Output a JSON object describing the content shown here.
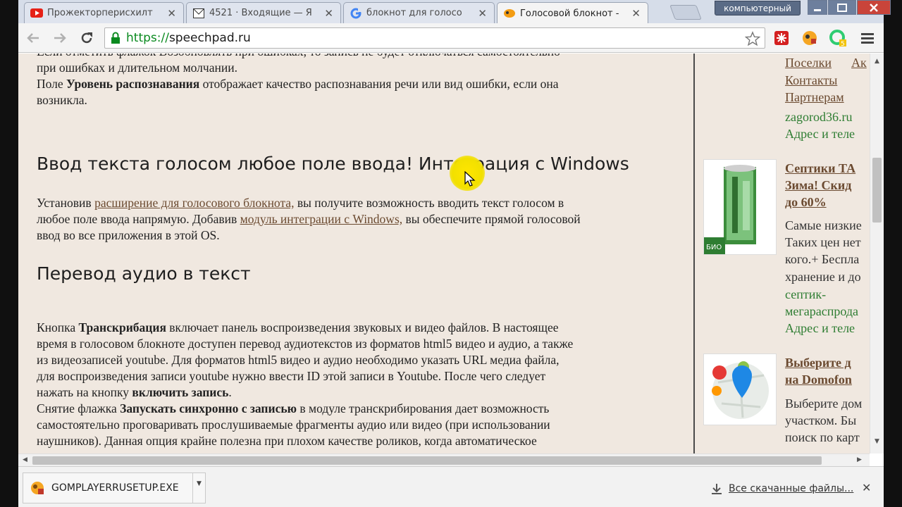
{
  "browser": {
    "tabs": [
      {
        "icon": "youtube-icon",
        "title": "Прожекторперисхилт"
      },
      {
        "icon": "mail-icon",
        "title": "4521 · Входящие — Я"
      },
      {
        "icon": "google-icon",
        "title": "блокнот для голосо"
      },
      {
        "icon": "speechpad-icon",
        "title": "Голосовой блокнот -"
      }
    ],
    "profile_label": "компьютерный",
    "url_scheme": "https://",
    "url_host": "speechpad.ru"
  },
  "article": {
    "p0_line1": "Если отметить флажок Возобновлять при ошибках, то запись не будет отключаться самостоятельно",
    "p0_line2": "при ошибках и длительном молчании.",
    "p1_pre": "Поле ",
    "p1_bold": "Уровень распознавания",
    "p1_post": " отображает качество распознавания речи или вид ошибки, если она",
    "p1_line2": "возникла.",
    "h_integration": "Ввод текста голосом любое поле ввода! Интеграция с Windows",
    "p2_pre": "Установив ",
    "p2_link1": "расширение для голосового блокнота,",
    "p2_mid": " вы получите возможность вводить текст голосом в",
    "p2_line2_pre": "любое поле ввода напрямую. Добавив ",
    "p2_link2": "модуль интеграции с Windows,",
    "p2_line2_post": " вы обеспечите прямой голосовой",
    "p2_line3": "ввод во все приложения в этой OS.",
    "h_audio": "Перевод аудио в текст",
    "p3_pre": "Кнопка ",
    "p3_bold": "Транскрибация",
    "p3_post": " включает панель воспроизведения звуковых и видео файлов. В настоящее",
    "p3_l2": "время в голосовом блокноте доступен перевод аудиотекстов из форматов html5 видео и аудио, а также",
    "p3_l3": "из видеозаписей youtube. Для форматов html5 видео и аудио необходимо указать URL медиа файла,",
    "p3_l4": "для воспроизведения записи youtube нужно ввести ID этой записи в Youtube. После чего следует",
    "p3_l5_pre": "нажать на кнопку ",
    "p3_l5_bold": "включить запись",
    "p3_l5_post": ".",
    "p4_pre": "Снятие флажка ",
    "p4_bold": "Запускать синхронно с записью",
    "p4_post": " в модуле транскрибирования дает возможность",
    "p4_l2": "самостоятельно проговаривать прослушиваемые фрагменты аудио или видео (при использовании",
    "p4_l3": "наушников). Данная опция крайне полезна при плохом качестве роликов, когда автоматическое"
  },
  "sidebar": {
    "link_poselki": "Поселки",
    "link_ak": "Ак",
    "link_contacts": "Контакты",
    "link_partners": "Партнерам",
    "domain1": "zagorod36.ru",
    "addr1": "Адрес и теле",
    "ad1_title_l1": "Септики ТА",
    "ad1_title_l2": "Зима! Скид",
    "ad1_title_l3": "до 60%",
    "ad1_text_l1": "Самые низкие",
    "ad1_text_l2": "Таких цен нет",
    "ad1_text_l3": "кого.+ Беспла",
    "ad1_text_l4": "хранение и до",
    "ad1_domain_l1": "септик-",
    "ad1_domain_l2": "мегараспрода",
    "ad1_addr": "Адрес и теле",
    "ad1_img_label": "БИО",
    "ad2_title_l1": "Выберите д",
    "ad2_title_l2": "на Domofon",
    "ad2_text_l1": "Выберите дом",
    "ad2_text_l2": "участком. Бы",
    "ad2_text_l3": "поиск по карт"
  },
  "downloads": {
    "file_name": "GOMPLAYERRUSETUP.EXE",
    "all_label": "Все скачанные файлы..."
  },
  "colors": {
    "page_bg": "#f0e8e0",
    "link": "#6b4a30",
    "green": "#2e7d32",
    "scheme_green": "#0a8a1f"
  }
}
